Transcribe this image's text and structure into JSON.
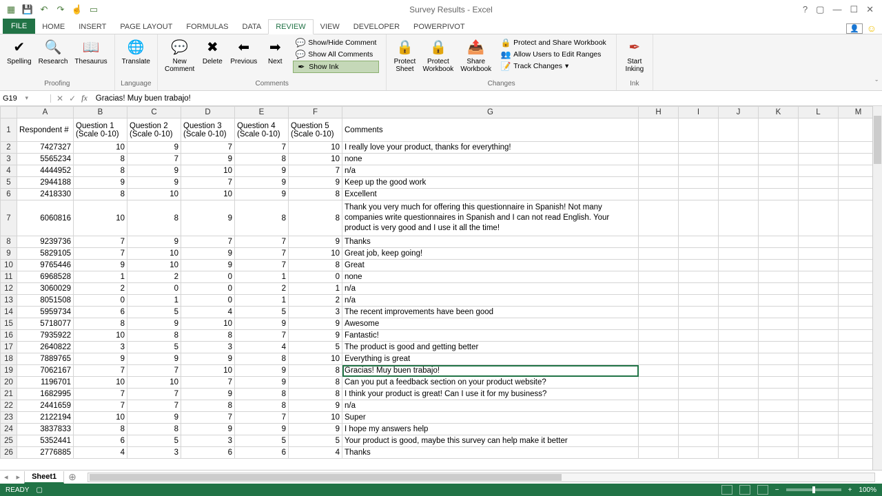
{
  "app": {
    "title": "Survey Results - Excel"
  },
  "qat_icons": [
    "excel-icon",
    "save-icon",
    "undo-icon",
    "redo-icon",
    "touch-icon",
    "calendar-icon"
  ],
  "tabs": [
    "FILE",
    "HOME",
    "INSERT",
    "PAGE LAYOUT",
    "FORMULAS",
    "DATA",
    "REVIEW",
    "VIEW",
    "DEVELOPER",
    "POWERPIVOT"
  ],
  "active_tab": "REVIEW",
  "ribbon": {
    "proofing": {
      "label": "Proofing",
      "spelling": "Spelling",
      "research": "Research",
      "thesaurus": "Thesaurus"
    },
    "language": {
      "label": "Language",
      "translate": "Translate"
    },
    "comments": {
      "label": "Comments",
      "new": "New\nComment",
      "delete": "Delete",
      "previous": "Previous",
      "next": "Next",
      "show_hide": "Show/Hide Comment",
      "show_all": "Show All Comments",
      "show_ink": "Show Ink"
    },
    "changes": {
      "label": "Changes",
      "protect_sheet": "Protect\nSheet",
      "protect_wb": "Protect\nWorkbook",
      "share_wb": "Share\nWorkbook",
      "protect_share": "Protect and Share Workbook",
      "allow_edit": "Allow Users to Edit Ranges",
      "track": "Track Changes"
    },
    "ink": {
      "label": "Ink",
      "start": "Start\nInking"
    }
  },
  "namebox": "G19",
  "formula": "Gracias! Muy buen trabajo!",
  "columns": [
    "A",
    "B",
    "C",
    "D",
    "E",
    "F",
    "G",
    "H",
    "I",
    "J",
    "K",
    "L",
    "M"
  ],
  "headers_row1": [
    "Respondent #",
    "Question 1",
    "Question 2",
    "Question 3",
    "Question 4",
    "Question 5",
    ""
  ],
  "headers_row2": [
    "",
    "(Scale 0-10)",
    "(Scale 0-10)",
    "(Scale 0-10)",
    "(Scale 0-10)",
    "(Scale 0-10)",
    "Comments"
  ],
  "rows": [
    {
      "r": 2,
      "a": 7427327,
      "b": 10,
      "c": 9,
      "d": 7,
      "e": 7,
      "f": 10,
      "g": "I really love your product, thanks for everything!"
    },
    {
      "r": 3,
      "a": 5565234,
      "b": 8,
      "c": 7,
      "d": 9,
      "e": 8,
      "f": 10,
      "g": "none"
    },
    {
      "r": 4,
      "a": 4444952,
      "b": 8,
      "c": 9,
      "d": 10,
      "e": 9,
      "f": 7,
      "g": "n/a"
    },
    {
      "r": 5,
      "a": 2944188,
      "b": 9,
      "c": 9,
      "d": 7,
      "e": 9,
      "f": 9,
      "g": "Keep up the good work"
    },
    {
      "r": 6,
      "a": 2418330,
      "b": 8,
      "c": 10,
      "d": 10,
      "e": 9,
      "f": 8,
      "g": "Excellent"
    },
    {
      "r": 7,
      "a": 6060816,
      "b": 10,
      "c": 8,
      "d": 9,
      "e": 8,
      "f": 8,
      "g": "Thank you very much for offering this questionnaire in Spanish! Not many companies write questionnaires in Spanish and I can not read English. Your product is very good and I use it all the time!",
      "wrap": true
    },
    {
      "r": 8,
      "a": 9239736,
      "b": 7,
      "c": 9,
      "d": 7,
      "e": 7,
      "f": 9,
      "g": "Thanks"
    },
    {
      "r": 9,
      "a": 5829105,
      "b": 7,
      "c": 10,
      "d": 9,
      "e": 7,
      "f": 10,
      "g": "Great job, keep going!"
    },
    {
      "r": 10,
      "a": 9765446,
      "b": 9,
      "c": 10,
      "d": 9,
      "e": 7,
      "f": 8,
      "g": "Great"
    },
    {
      "r": 11,
      "a": 6968528,
      "b": 1,
      "c": 2,
      "d": 0,
      "e": 1,
      "f": 0,
      "g": "none"
    },
    {
      "r": 12,
      "a": 3060029,
      "b": 2,
      "c": 0,
      "d": 0,
      "e": 2,
      "f": 1,
      "g": "n/a"
    },
    {
      "r": 13,
      "a": 8051508,
      "b": 0,
      "c": 1,
      "d": 0,
      "e": 1,
      "f": 2,
      "g": "n/a"
    },
    {
      "r": 14,
      "a": 5959734,
      "b": 6,
      "c": 5,
      "d": 4,
      "e": 5,
      "f": 3,
      "g": "The recent improvements have been good"
    },
    {
      "r": 15,
      "a": 5718077,
      "b": 8,
      "c": 9,
      "d": 10,
      "e": 9,
      "f": 9,
      "g": "Awesome"
    },
    {
      "r": 16,
      "a": 7935922,
      "b": 10,
      "c": 8,
      "d": 8,
      "e": 7,
      "f": 9,
      "g": "Fantastic!"
    },
    {
      "r": 17,
      "a": 2640822,
      "b": 3,
      "c": 5,
      "d": 3,
      "e": 4,
      "f": 5,
      "g": "The product is good and getting better"
    },
    {
      "r": 18,
      "a": 7889765,
      "b": 9,
      "c": 9,
      "d": 9,
      "e": 8,
      "f": 10,
      "g": "Everything is great"
    },
    {
      "r": 19,
      "a": 7062167,
      "b": 7,
      "c": 7,
      "d": 10,
      "e": 9,
      "f": 8,
      "g": "Gracias! Muy buen trabajo!",
      "sel": true
    },
    {
      "r": 20,
      "a": 1196701,
      "b": 10,
      "c": 10,
      "d": 7,
      "e": 9,
      "f": 8,
      "g": "Can you put a feedback section on your product website?"
    },
    {
      "r": 21,
      "a": 1682995,
      "b": 7,
      "c": 7,
      "d": 9,
      "e": 8,
      "f": 8,
      "g": "I think your product is great! Can I use it for my business?"
    },
    {
      "r": 22,
      "a": 2441659,
      "b": 7,
      "c": 7,
      "d": 8,
      "e": 8,
      "f": 9,
      "g": "n/a"
    },
    {
      "r": 23,
      "a": 2122194,
      "b": 10,
      "c": 9,
      "d": 7,
      "e": 7,
      "f": 10,
      "g": "Super"
    },
    {
      "r": 24,
      "a": 3837833,
      "b": 8,
      "c": 8,
      "d": 9,
      "e": 9,
      "f": 9,
      "g": "I hope my answers help"
    },
    {
      "r": 25,
      "a": 5352441,
      "b": 6,
      "c": 5,
      "d": 3,
      "e": 5,
      "f": 5,
      "g": "Your product is good, maybe this survey can help make it better"
    },
    {
      "r": 26,
      "a": 2776885,
      "b": 4,
      "c": 3,
      "d": 6,
      "e": 6,
      "f": 4,
      "g": "Thanks"
    }
  ],
  "sheet": {
    "name": "Sheet1"
  },
  "status": {
    "ready": "READY",
    "zoom": "100%"
  }
}
